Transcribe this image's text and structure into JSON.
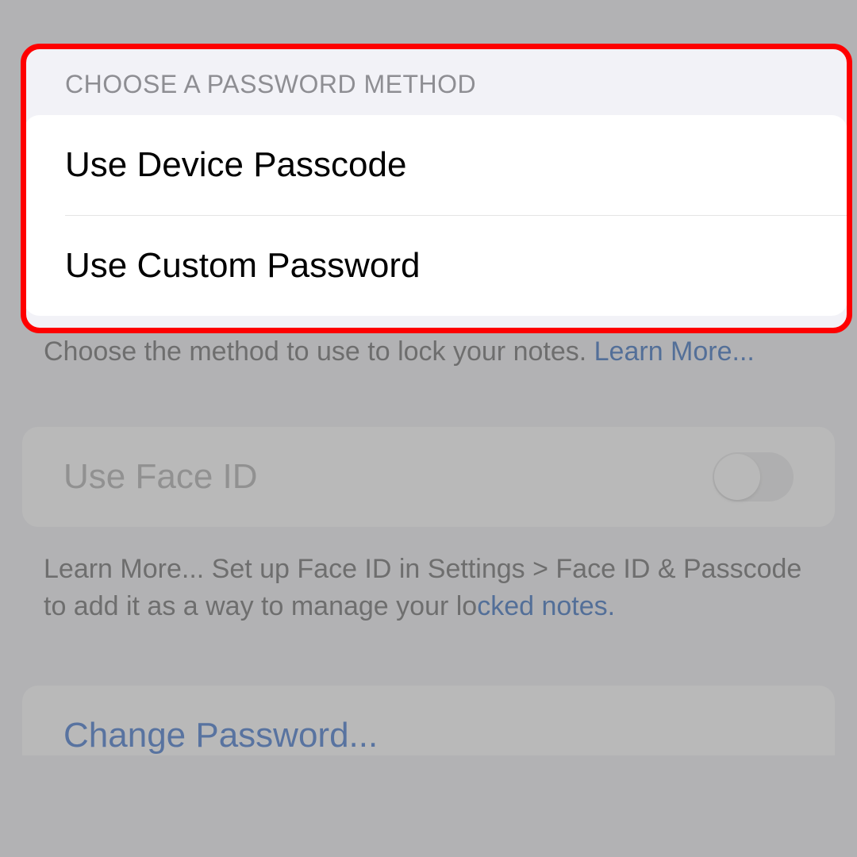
{
  "section_header": "Choose a Password Method",
  "options": {
    "device_passcode": "Use Device Passcode",
    "custom_password": "Use Custom Password"
  },
  "description_text": "Choose the method to use to lock your notes. ",
  "description_link": "Learn More...",
  "face_id": {
    "label": "Use Face ID",
    "toggle_state": false
  },
  "face_id_description_prefix": "Learn More... Set up Face ID in Settings > Face ID & Passcode to add it as a way to manage your lo",
  "face_id_description_link": "cked notes.",
  "change_password_label": "Change Password..."
}
